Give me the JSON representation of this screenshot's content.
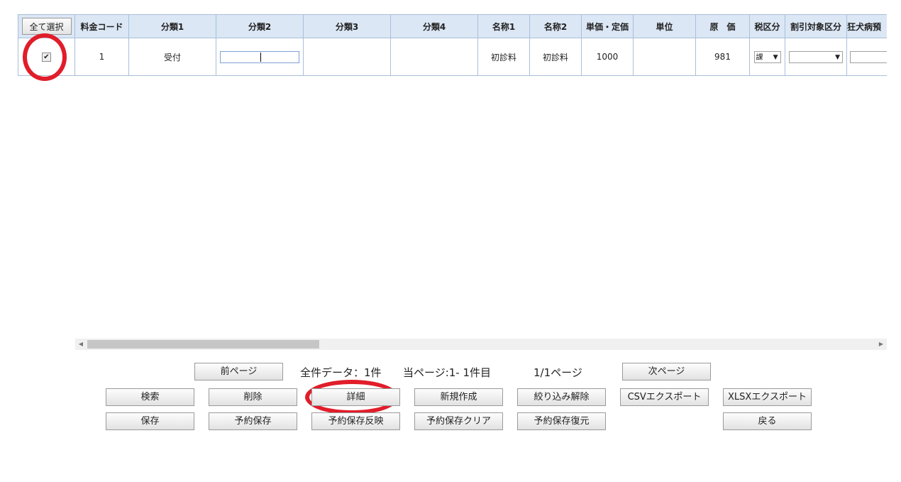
{
  "grid": {
    "select_all_label": "全て選択",
    "headers": [
      "料金コード",
      "分類1",
      "分類2",
      "分類3",
      "分類4",
      "名称1",
      "名称2",
      "単価・定価",
      "単位",
      "原　価",
      "税区分",
      "割引対象区分",
      "狂犬病預"
    ],
    "row": {
      "checked": true,
      "code": "1",
      "cat1": "受付",
      "cat2_value": "",
      "cat3": "",
      "cat4": "",
      "name1": "初診料",
      "name2": "初診料",
      "price": "1000",
      "unit": "",
      "cost": "981",
      "tax_value": "課",
      "discount_value": ""
    },
    "check_glyph": "✔"
  },
  "pager": {
    "prev_label": "前ページ",
    "total_text": "全件データ：1件",
    "current_text": "当ページ:1- 1件目",
    "page_text": "1/1ページ",
    "next_label": "次ページ"
  },
  "actions": {
    "search": "検索",
    "delete": "削除",
    "detail": "詳細",
    "new": "新規作成",
    "clear_filter": "絞り込み解除",
    "csv_export": "CSVエクスポート",
    "xlsx_export": "XLSXエクスポート",
    "save": "保存",
    "reserve_save": "予約保存",
    "reserve_apply": "予約保存反映",
    "reserve_clear": "予約保存クリア",
    "reserve_restore": "予約保存復元",
    "back": "戻る"
  },
  "colors": {
    "annotation": "#e11d2a",
    "header_bg": "#dce7f5",
    "border": "#a9bfd9"
  }
}
